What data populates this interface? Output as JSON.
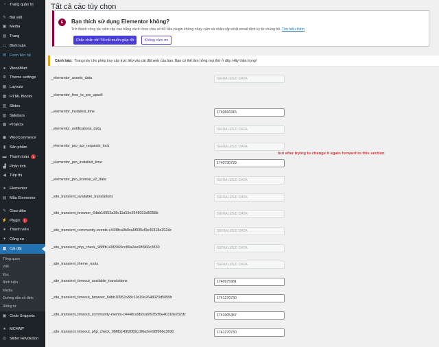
{
  "sidebar": {
    "items": [
      {
        "label": "Trang quản trị",
        "icon": "dashboard-icon",
        "glyph": "◔"
      },
      {
        "sep": true
      },
      {
        "label": "Bài viết",
        "icon": "pin-icon",
        "glyph": "✎"
      },
      {
        "label": "Media",
        "icon": "media-icon",
        "glyph": "▣"
      },
      {
        "label": "Trang",
        "icon": "page-icon",
        "glyph": "▤"
      },
      {
        "label": "Bình luận",
        "icon": "comment-icon",
        "glyph": "▭"
      },
      {
        "label": "Form liên hệ",
        "icon": "mail-icon",
        "glyph": "✉",
        "highlight": true
      },
      {
        "sep": true
      },
      {
        "label": "WoodMart",
        "icon": "woodmart-icon",
        "glyph": "●"
      },
      {
        "label": "Theme settings",
        "icon": "settings-icon",
        "glyph": "⚙"
      },
      {
        "label": "Layouts",
        "icon": "layouts-icon",
        "glyph": "▦"
      },
      {
        "label": "HTML Blocks",
        "icon": "html-blocks-icon",
        "glyph": "▦"
      },
      {
        "label": "Slides",
        "icon": "slides-icon",
        "glyph": "▥"
      },
      {
        "label": "Sidebars",
        "icon": "sidebars-icon",
        "glyph": "▥"
      },
      {
        "label": "Projects",
        "icon": "projects-icon",
        "glyph": "▩"
      },
      {
        "sep": true
      },
      {
        "label": "WooCommerce",
        "icon": "woocommerce-icon",
        "glyph": "◼"
      },
      {
        "label": "Sản phẩm",
        "icon": "products-icon",
        "glyph": "▮"
      },
      {
        "label": "Thanh toán",
        "icon": "payments-icon",
        "glyph": "▬",
        "badge": "1"
      },
      {
        "label": "Phân tích",
        "icon": "analytics-icon",
        "glyph": "▟"
      },
      {
        "label": "Tiếp thị",
        "icon": "marketing-icon",
        "glyph": "◀"
      },
      {
        "sep": true
      },
      {
        "label": "Elementor",
        "icon": "elementor-icon",
        "glyph": "●"
      },
      {
        "label": "Mẫu Elementor",
        "icon": "templates-icon",
        "glyph": "▤"
      },
      {
        "sep": true
      },
      {
        "label": "Giao diện",
        "icon": "appearance-icon",
        "glyph": "✎"
      },
      {
        "label": "Plugin",
        "icon": "plugin-icon",
        "glyph": "⚡",
        "badge": "1"
      },
      {
        "label": "Thành viên",
        "icon": "users-icon",
        "glyph": "●"
      },
      {
        "label": "Công cụ",
        "icon": "tools-icon",
        "glyph": "✦"
      },
      {
        "label": "Cài đặt",
        "icon": "settings-sliders-icon",
        "glyph": "▦",
        "active": true
      }
    ],
    "submenu": [
      "Tổng quan",
      "Viết",
      "Đọc",
      "Bình luận",
      "Media",
      "Đường dẫn cố định",
      "Riêng tư"
    ],
    "items_bottom": [
      {
        "label": "Code Snippets",
        "icon": "code-snippets-icon",
        "glyph": "▣"
      },
      {
        "sep": true
      },
      {
        "label": "MC4WP",
        "icon": "mc4wp-icon",
        "glyph": "●"
      },
      {
        "label": "Slider Revolution",
        "icon": "slider-revolution-icon",
        "glyph": "◎"
      }
    ]
  },
  "page": {
    "title": "Tất cả các tùy chọn"
  },
  "notice": {
    "logo_text": "E",
    "title": "Bạn thích sử dụng Elementor không?",
    "text": "Trở thành cộng tác viên cập cao bằng cách chon chia sẻ dữ liệu plugin không nhay cảm và nhận cập nhật email định kỳ từ chúng tôi.",
    "link": "Tìm hiểu thêm",
    "accept_label": "Chắc chắn rồi! Tôi rất muốn giúp đỡ",
    "decline_label": "Không cảm ơn"
  },
  "warning": {
    "label": "Cảnh báo:",
    "text": "Trang này cho phép truy cập trực tiếp vào cài đặt web của bạn. Bạn có thể làm hỏng mọi thứ ở đây. Hãy thận trọng!"
  },
  "annotation": "but after trying to change it again forward to this section",
  "options": [
    {
      "name": "_elementor_assets_data",
      "value": "SERIALIZED DATA",
      "serialized": true
    },
    {
      "name": "_elementor_free_to_pro_upsell",
      "value": "",
      "serialized": false,
      "empty": true
    },
    {
      "name": "_elementor_installed_time",
      "value": "1740666315",
      "serialized": false
    },
    {
      "name": "_elementor_notifications_data",
      "value": "SERIALIZED DATA",
      "serialized": true
    },
    {
      "name": "_elementor_pro_api_requests_lock",
      "value": "SERIALIZED DATA",
      "serialized": true
    },
    {
      "name": "_elementor_pro_installed_time",
      "value": "1740730729",
      "serialized": false
    },
    {
      "name": "_elementor_pro_license_v2_data",
      "value": "SERIALIZED DATA",
      "serialized": true
    },
    {
      "name": "_site_transient_available_translations",
      "value": "SERIALIZED DATA",
      "serialized": true
    },
    {
      "name": "_site_transient_browser_6dbb10952a38c11d19e2648023d5055b",
      "value": "SERIALIZED DATA",
      "serialized": true
    },
    {
      "name": "_site_transient_community-events-c4448ca9b0ca6f935cf0e40318e202dc",
      "value": "SERIALIZED DATA",
      "serialized": true
    },
    {
      "name": "_site_transient_php_check_988fb149f2069cc86a2ee98f966c3830",
      "value": "SERIALIZED DATA",
      "serialized": true
    },
    {
      "name": "_site_transient_theme_roots",
      "value": "SERIALIZED DATA",
      "serialized": true
    },
    {
      "name": "_site_transient_timeout_available_translations",
      "value": "1740975981",
      "serialized": false
    },
    {
      "name": "_site_transient_timeout_browser_6dbb10952a38c11d19e2648023d5055b",
      "value": "1741270730",
      "serialized": false
    },
    {
      "name": "_site_transient_timeout_community-events-c4448ca9b0ca6f935cf0e40318e202dc",
      "value": "1741005457",
      "serialized": false
    },
    {
      "name": "_site_transient_timeout_php_check_988fb149f2069cc86a2ee98f966c3830",
      "value": "1741270730",
      "serialized": false
    }
  ],
  "colors": {
    "sidebar_bg": "#1d2327",
    "active": "#2271b1",
    "elementor": "#92003b",
    "button": "#4a3dd6",
    "warning_border": "#dba617",
    "annotation": "#d63638"
  }
}
